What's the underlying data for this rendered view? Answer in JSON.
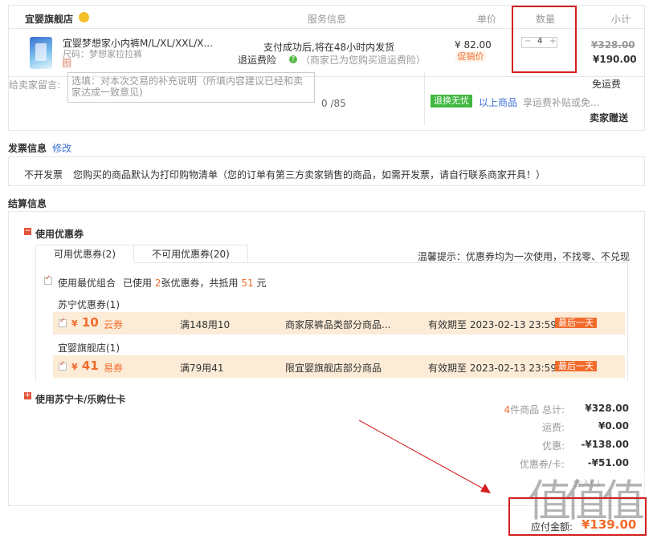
{
  "order": {
    "shop_name": "宜婴旗舰店",
    "headers": {
      "service": "服务信息",
      "price": "单价",
      "quantity": "数量",
      "subtotal": "小计"
    },
    "item": {
      "title": "宜婴梦想家小内裤M/L/XL/XXL/X...",
      "size": "尺码：梦想家拉拉裤",
      "tag": "图",
      "service_line": "支付成功后,将在48小时内发货",
      "service_label": "退运费险",
      "service_note": "（商家已为您购买退运费险）",
      "price": "¥ 82.00",
      "promo": "促销价",
      "qty_minus": "−",
      "quantity": "4",
      "qty_plus": "+",
      "subtotal_original": "¥328.00",
      "subtotal_final": "¥190.00"
    },
    "message_label": "给卖家留言:",
    "message_placeholder": "选填：对本次交易的补充说明（所填内容建议已经和卖家达成一致意见)",
    "message_count": "0 /85",
    "shipping": {
      "free": "免运费",
      "tag": "退换无忧",
      "link": "以上商品",
      "note": "享运费补贴或免...",
      "gift": "卖家赠送"
    }
  },
  "invoice": {
    "title": "发票信息",
    "edit": "修改",
    "type": "不开发票",
    "note": "您购买的商品默认为打印购物清单（您的订单有第三方卖家销售的商品，如需开发票，请自行联系商家开具！）"
  },
  "settlement": {
    "title": "结算信息",
    "coupon_toggle": "−",
    "coupon_title": "使用优惠券",
    "tabs": [
      "可用优惠券(2)",
      "不可用优惠券(20)"
    ],
    "tip": "温馨提示：优惠券均为一次使用，不找零、不兑现",
    "best_label": "使用最优组合",
    "best_prefix": "已使用",
    "best_count": "2",
    "best_mid": "张优惠券，共抵用",
    "best_amount": "51",
    "best_suffix": "元",
    "groups": [
      {
        "name": "苏宁优惠券(1)",
        "yen": "¥",
        "amount": "10",
        "type": "云券",
        "condition": "满148用10",
        "scope": "商家尿裤品类部分商品...",
        "expire": "有效期至 2023-02-13 23:59",
        "badge": "最后一天"
      },
      {
        "name": "宜婴旗舰店(1)",
        "yen": "¥",
        "amount": "41",
        "type": "易券",
        "condition": "满79用41",
        "scope": "限宜婴旗舰店部分商品",
        "expire": "有效期至 2023-02-13 23:59",
        "badge": "最后一天"
      }
    ],
    "card_toggle": "+",
    "card_title": "使用苏宁卡/乐购仕卡",
    "summary": [
      {
        "label_hl": "4",
        "label": "件商品 总计:",
        "value": "¥328.00"
      },
      {
        "label_hl": "",
        "label": "运费:",
        "value": "¥0.00"
      },
      {
        "label_hl": "",
        "label": "优惠:",
        "value": "-¥138.00"
      },
      {
        "label_hl": "",
        "label": "优惠券/卡:",
        "value": "-¥51.00"
      }
    ],
    "sub_mini": "含入(.)",
    "pay_label": "应付金额:",
    "pay_value": "¥139.00"
  },
  "watermark": "值值值",
  "colors": {
    "accent": "#f26b2b",
    "link": "#3b6fd4",
    "callout": "#d42020",
    "coupon_bg": "#fcebd6",
    "green_tag": "#3fb83f"
  }
}
